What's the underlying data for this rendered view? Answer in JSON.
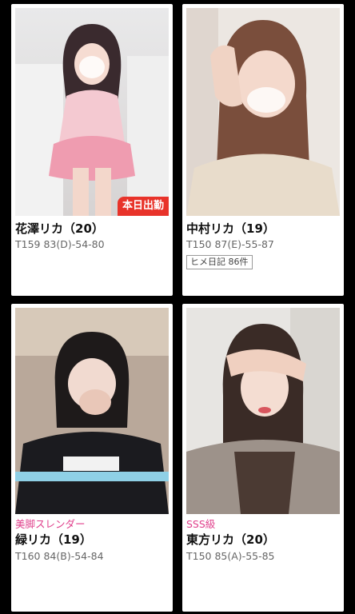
{
  "cards": [
    {
      "name": "花澤リカ（20）",
      "stats": "T159 83(D)-54-80",
      "badge": "本日出勤",
      "photo_icon": "profile-photo"
    },
    {
      "name": "中村リカ（19）",
      "stats": "T150 87(E)-55-87",
      "diary": "ヒメ日記 86件",
      "photo_icon": "profile-photo"
    },
    {
      "tag": "美脚スレンダー",
      "name": "緑リカ（19）",
      "stats": "T160 84(B)-54-84",
      "photo_icon": "profile-photo"
    },
    {
      "tag": "SSS級",
      "name": "東方リカ（20）",
      "stats": "T150 85(A)-55-85",
      "photo_icon": "profile-photo"
    }
  ],
  "colors": {
    "background": "#000000",
    "badge": "#e8332a",
    "tag": "#e0408c"
  }
}
